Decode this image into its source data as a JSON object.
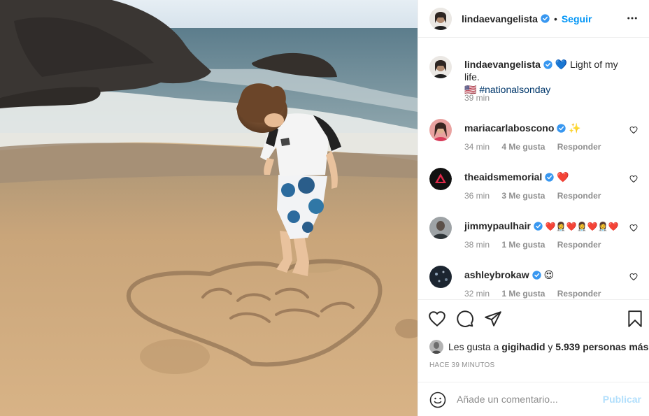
{
  "post": {
    "username": "lindaevangelista",
    "verified": true,
    "separator": "•",
    "follow_label": "Seguir",
    "more_icon": "more-horizontal-icon"
  },
  "caption": {
    "username": "lindaevangelista",
    "heart": "💙",
    "text": "Light of my life.",
    "extra": "🇺🇸",
    "hashtag": "#nationalsonday",
    "time": "39 min"
  },
  "comments": [
    {
      "username": "mariacarlaboscono",
      "text": "✨",
      "time": "34 min",
      "likes": "4 Me gusta",
      "reply": "Responder"
    },
    {
      "username": "theaidsmemorial",
      "text": "❤️",
      "time": "36 min",
      "likes": "3 Me gusta",
      "reply": "Responder"
    },
    {
      "username": "jimmypaulhair",
      "text": "❤️👩‍⚕️❤️👩‍⚕️❤️👩‍⚕️❤️",
      "time": "38 min",
      "likes": "1 Me gusta",
      "reply": "Responder"
    },
    {
      "username": "ashleybrokaw",
      "text": "😍",
      "time": "32 min",
      "likes": "1 Me gusta",
      "reply": "Responder"
    }
  ],
  "likes_line": {
    "prefix": "Les gusta a",
    "user": "gigihadid",
    "and": "y",
    "others": "5.939 personas más"
  },
  "timestamp": "HACE 39 MINUTOS",
  "add_comment": {
    "placeholder": "Añade un comentario...",
    "publish_label": "Publicar"
  },
  "colors": {
    "accent": "#0095f6",
    "text": "#262626",
    "muted": "#8e8e8e",
    "border": "#efefef",
    "publish_disabled": "#b2dffc",
    "verified": "#3897f0"
  }
}
